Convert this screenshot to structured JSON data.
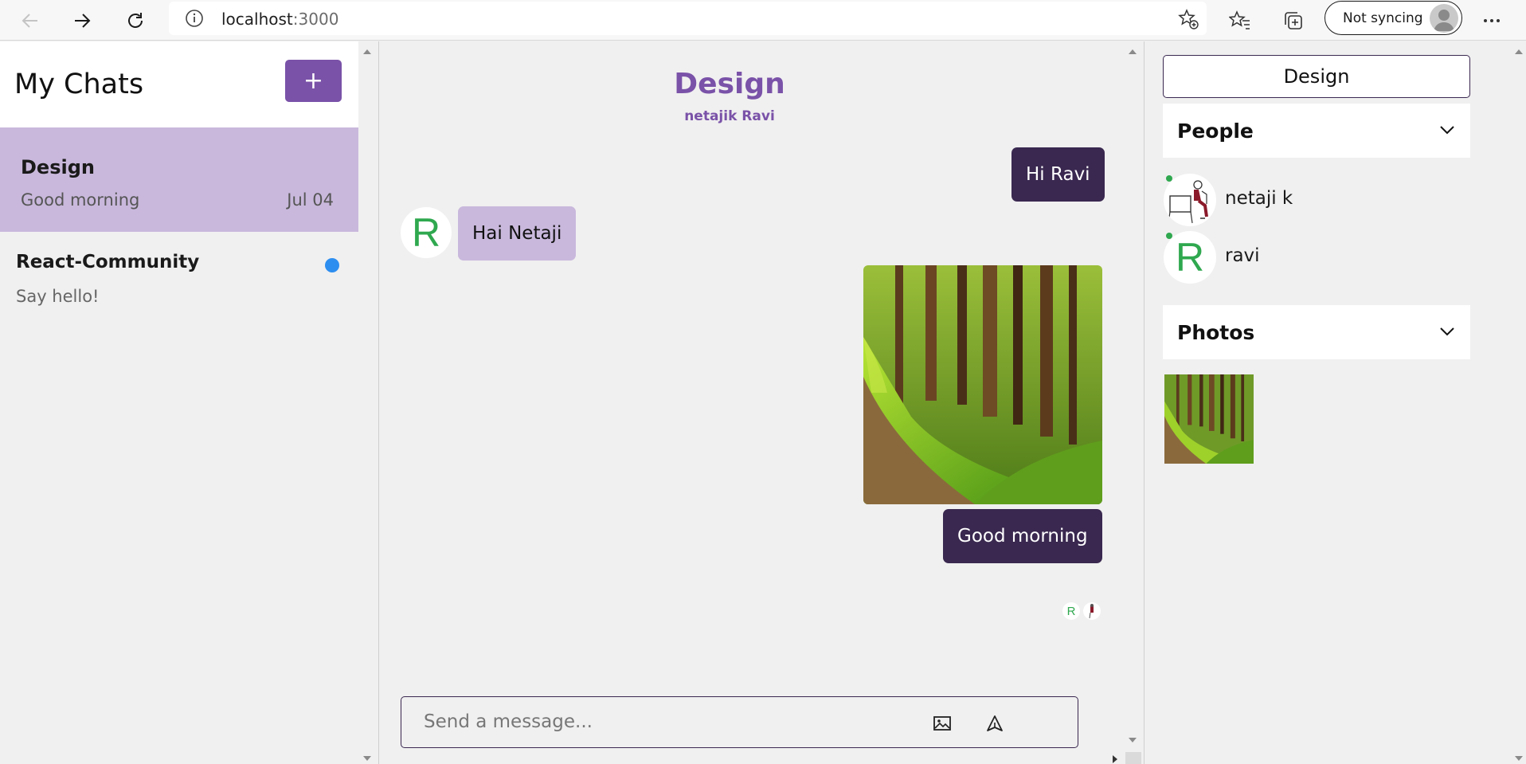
{
  "browser": {
    "url_host": "localhost",
    "url_port": ":3000",
    "sync_label": "Not syncing"
  },
  "sidebar": {
    "title": "My Chats",
    "add_label": "+",
    "chats": [
      {
        "name": "Design",
        "preview": "Good morning",
        "date": "Jul 04",
        "active": true
      },
      {
        "name": "React-Community",
        "preview": "Say hello!",
        "unread": true
      }
    ]
  },
  "chat": {
    "title": "Design",
    "subtitle": "netajik Ravi",
    "messages": [
      {
        "direction": "out",
        "text": "Hi Ravi"
      },
      {
        "direction": "in",
        "text": "Hai Netaji",
        "avatar": "R"
      },
      {
        "direction": "out",
        "type": "image"
      },
      {
        "direction": "out",
        "text": "Good morning"
      }
    ],
    "read_receipt_initial": "R",
    "input_placeholder": "Send a message..."
  },
  "details": {
    "group_button": "Design",
    "people_title": "People",
    "people": [
      {
        "name": "netaji k"
      },
      {
        "name": "ravi",
        "initial": "R"
      }
    ],
    "photos_title": "Photos"
  },
  "colors": {
    "accent": "#7a52a8",
    "bubble_out": "#3a2850",
    "bubble_in": "#c9b8dc",
    "unread": "#2d8ef0",
    "online": "#2fa84f"
  }
}
